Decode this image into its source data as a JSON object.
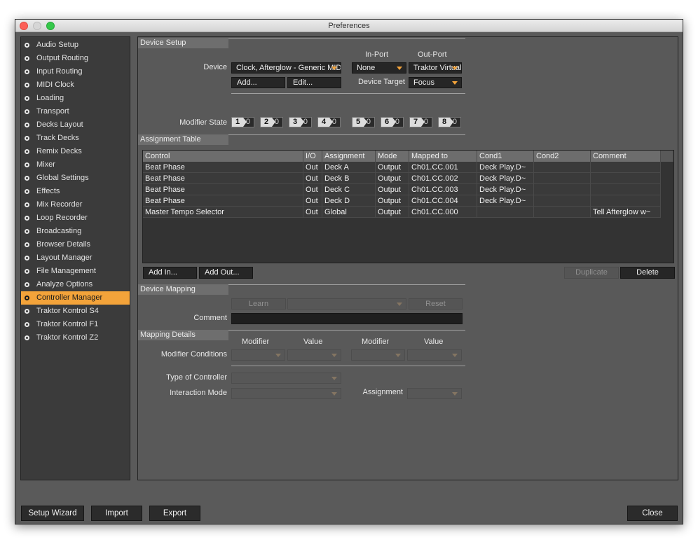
{
  "window": {
    "title": "Preferences"
  },
  "sidebar": {
    "items": [
      {
        "label": "Audio Setup"
      },
      {
        "label": "Output Routing"
      },
      {
        "label": "Input Routing"
      },
      {
        "label": "MIDI Clock"
      },
      {
        "label": "Loading"
      },
      {
        "label": "Transport"
      },
      {
        "label": "Decks Layout"
      },
      {
        "label": "Track Decks"
      },
      {
        "label": "Remix Decks"
      },
      {
        "label": "Mixer"
      },
      {
        "label": "Global Settings"
      },
      {
        "label": "Effects"
      },
      {
        "label": "Mix Recorder"
      },
      {
        "label": "Loop Recorder"
      },
      {
        "label": "Broadcasting"
      },
      {
        "label": "Browser Details"
      },
      {
        "label": "Layout Manager"
      },
      {
        "label": "File Management"
      },
      {
        "label": "Analyze Options"
      },
      {
        "label": "Controller Manager",
        "selected": true
      },
      {
        "label": "Traktor Kontrol S4"
      },
      {
        "label": "Traktor Kontrol F1"
      },
      {
        "label": "Traktor Kontrol Z2"
      }
    ]
  },
  "device_setup": {
    "header": "Device Setup",
    "device_label": "Device",
    "device_value": "Clock, Afterglow - Generic MIDI",
    "in_port_label": "In-Port",
    "in_port_value": "None",
    "out_port_label": "Out-Port",
    "out_port_value": "Traktor Virtual Output",
    "add_button": "Add...",
    "edit_button": "Edit...",
    "device_target_label": "Device Target",
    "device_target_value": "Focus",
    "modifier_state_label": "Modifier State",
    "modifiers": [
      {
        "n": "1",
        "v": "0"
      },
      {
        "n": "2",
        "v": "0"
      },
      {
        "n": "3",
        "v": "0"
      },
      {
        "n": "4",
        "v": "0"
      },
      {
        "n": "5",
        "v": "0"
      },
      {
        "n": "6",
        "v": "0"
      },
      {
        "n": "7",
        "v": "0"
      },
      {
        "n": "8",
        "v": "0"
      }
    ]
  },
  "assignment_table": {
    "header": "Assignment Table",
    "columns": [
      "Control",
      "I/O",
      "Assignment",
      "Mode",
      "Mapped to",
      "Cond1",
      "Cond2",
      "Comment"
    ],
    "rows": [
      [
        "Beat Phase",
        "Out",
        "Deck A",
        "Output",
        "Ch01.CC.001",
        "Deck Play.D~",
        "",
        ""
      ],
      [
        "Beat Phase",
        "Out",
        "Deck B",
        "Output",
        "Ch01.CC.002",
        "Deck Play.D~",
        "",
        ""
      ],
      [
        "Beat Phase",
        "Out",
        "Deck C",
        "Output",
        "Ch01.CC.003",
        "Deck Play.D~",
        "",
        ""
      ],
      [
        "Beat Phase",
        "Out",
        "Deck D",
        "Output",
        "Ch01.CC.004",
        "Deck Play.D~",
        "",
        ""
      ],
      [
        "Master Tempo Selector",
        "Out",
        "Global",
        "Output",
        "Ch01.CC.000",
        "",
        "",
        "Tell Afterglow w~"
      ]
    ],
    "add_in_button": "Add In...",
    "add_out_button": "Add Out...",
    "duplicate_button": "Duplicate",
    "delete_button": "Delete"
  },
  "device_mapping": {
    "header": "Device Mapping",
    "learn_button": "Learn",
    "reset_button": "Reset",
    "comment_label": "Comment",
    "comment_value": ""
  },
  "mapping_details": {
    "header": "Mapping Details",
    "modifier_label_1": "Modifier",
    "value_label_1": "Value",
    "modifier_label_2": "Modifier",
    "value_label_2": "Value",
    "modifier_conditions_label": "Modifier Conditions",
    "type_of_controller_label": "Type of Controller",
    "interaction_mode_label": "Interaction Mode",
    "assignment_label": "Assignment"
  },
  "footer": {
    "setup_wizard_button": "Setup Wizard",
    "import_button": "Import",
    "export_button": "Export",
    "close_button": "Close"
  },
  "colors": {
    "accent": "#f3a33a",
    "panel": "#595959",
    "sidebar": "#3b3b3b",
    "control": "#262626"
  }
}
